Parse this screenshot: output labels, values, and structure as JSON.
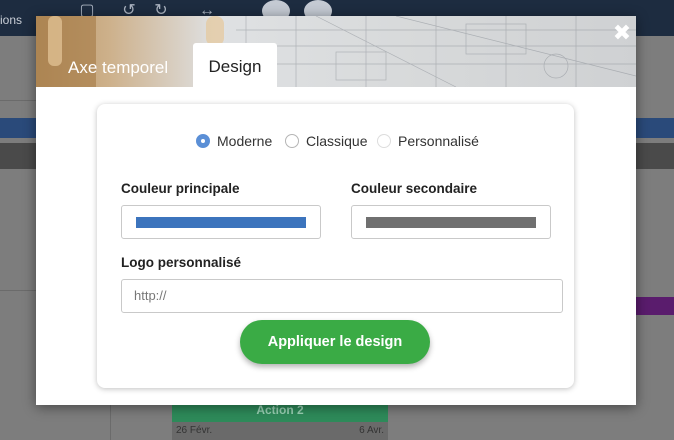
{
  "background": {
    "toolbar_left_label": "ions",
    "action_label": "Action 2",
    "start_date": "26 Févr.",
    "end_date": "6 Avr."
  },
  "modal": {
    "tabs": [
      {
        "label": "Axe temporel",
        "active": false
      },
      {
        "label": "Design",
        "active": true
      }
    ],
    "close_icon": "close-icon"
  },
  "design": {
    "style_options": [
      {
        "label": "Moderne",
        "checked": true
      },
      {
        "label": "Classique",
        "checked": false
      },
      {
        "label": "Personnalisé",
        "checked": false
      }
    ],
    "primary_color_label": "Couleur principale",
    "primary_color": "#3c74bd",
    "secondary_color_label": "Couleur secondaire",
    "secondary_color": "#707070",
    "logo_label": "Logo personnalisé",
    "logo_placeholder": "http://",
    "apply_label": "Appliquer le design",
    "apply_color": "#3aab45"
  }
}
